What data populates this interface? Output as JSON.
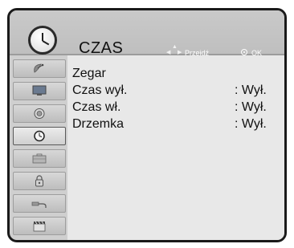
{
  "header": {
    "title": "CZAS",
    "move_hint": "Przejdź",
    "ok_hint": "OK"
  },
  "sidebar": {
    "items": [
      {
        "icon": "satellite-dish-icon",
        "active": false
      },
      {
        "icon": "monitor-icon",
        "active": false
      },
      {
        "icon": "speaker-icon",
        "active": false
      },
      {
        "icon": "clock-icon",
        "active": true
      },
      {
        "icon": "toolbox-icon",
        "active": false
      },
      {
        "icon": "lock-icon",
        "active": false
      },
      {
        "icon": "usb-plug-icon",
        "active": false
      },
      {
        "icon": "clapperboard-icon",
        "active": false
      }
    ]
  },
  "menu": {
    "rows": [
      {
        "label": "Zegar",
        "value": ""
      },
      {
        "label": "Czas wył.",
        "value": ": Wył."
      },
      {
        "label": "Czas wł.",
        "value": ": Wył."
      },
      {
        "label": "Drzemka",
        "value": ": Wył."
      }
    ]
  },
  "colors": {
    "frame": "#1a1a1a",
    "header_bg": "#c4c4c4",
    "content_bg": "#e8e8e8",
    "sidebar_bg": "#cfcfcf"
  }
}
